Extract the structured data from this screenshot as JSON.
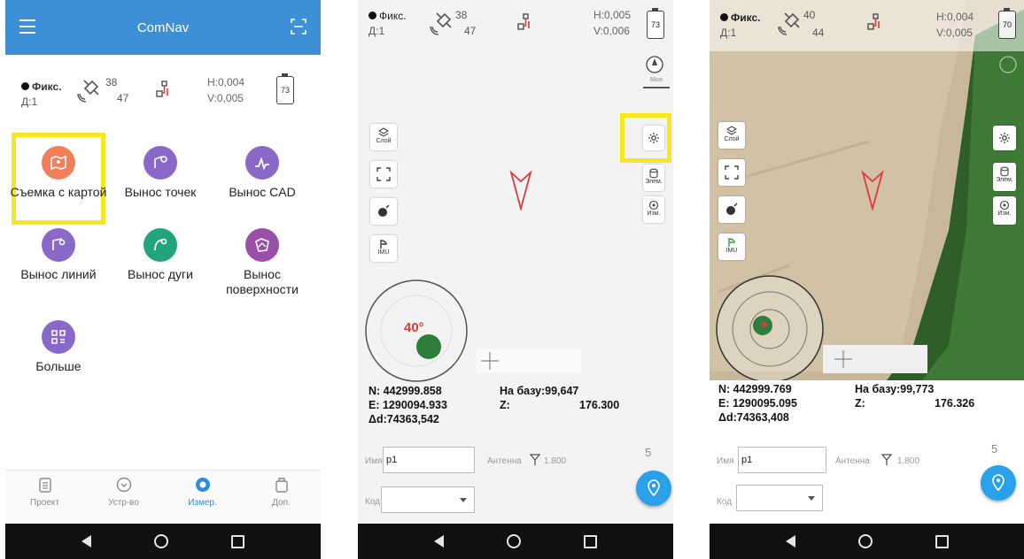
{
  "colors": {
    "accent": "#3d8fd6",
    "highlight": "#f7e620",
    "fab": "#29a0e8",
    "arrow": "#e23a3a",
    "tilt_dot": "#2e7d3a"
  },
  "panel1": {
    "title": "ComNav",
    "status": {
      "fix": "Фикс.",
      "diff": "Д:1",
      "sat_visible": "38",
      "sat_used": "47",
      "h": "H:0,004",
      "v": "V:0,005",
      "battery": "73"
    },
    "tiles": [
      {
        "label": "Съемка с картой",
        "icon": "map-pin-icon",
        "color": "#f07f5a"
      },
      {
        "label": "Вынос точек",
        "icon": "stakeout-point-icon",
        "color": "#8a68c8"
      },
      {
        "label": "Вынос CAD",
        "icon": "cad-line-icon",
        "color": "#8a68c8"
      },
      {
        "label": "Вынос линий",
        "icon": "stakeout-line-icon",
        "color": "#8a68c8"
      },
      {
        "label": "Вынос дуги",
        "icon": "arc-icon",
        "color": "#22a57c"
      },
      {
        "label": "Вынос поверхности",
        "icon": "surface-icon",
        "color": "#9a4fa8"
      },
      {
        "label": "Больше",
        "icon": "grid-icon",
        "color": "#8a68c8"
      }
    ],
    "bottom_tabs": [
      {
        "label": "Проект",
        "icon": "project-icon",
        "active": false
      },
      {
        "label": "Устр-во",
        "icon": "device-icon",
        "active": false
      },
      {
        "label": "Измер.",
        "icon": "measure-icon",
        "active": true
      },
      {
        "label": "Доп.",
        "icon": "extra-icon",
        "active": false
      }
    ]
  },
  "panel2": {
    "status": {
      "fix": "Фикс.",
      "diff": "Д:1",
      "sat_visible": "38",
      "sat_used": "47",
      "h": "H:0,005",
      "v": "V:0,006",
      "battery": "73"
    },
    "scale": "59cm",
    "controls": {
      "layer": "Слой",
      "imu": "IMU",
      "elements": "Элем.",
      "measure": "Изм."
    },
    "tilt": "40°",
    "coords": {
      "n": "N: 442999.858",
      "e": "E: 1290094.933",
      "ad": "Δd:74363,542",
      "base": "На базу:99,647",
      "z_label": "Z:",
      "z": "176.300"
    },
    "name_label": "Имя",
    "name_value": "p1",
    "antenna_label": "Антенна",
    "antenna_value": "1.800",
    "code_label": "Код",
    "count": "5"
  },
  "panel3": {
    "status": {
      "fix": "Фикс.",
      "diff": "Д:1",
      "sat_visible": "40",
      "sat_used": "44",
      "h": "H:0,004",
      "v": "V:0,005",
      "battery": "70"
    },
    "controls": {
      "layer": "Слой",
      "imu": "IMU",
      "elements": "Элем.",
      "measure": "Изм."
    },
    "coords": {
      "n": "N: 442999.769",
      "e": "E: 1290095.095",
      "ad": "Δd:74363,408",
      "base": "На базу:99,773",
      "z_label": "Z:",
      "z": "176.326"
    },
    "name_label": "Имя",
    "name_value": "p1",
    "antenna_label": "Антенна",
    "antenna_value": "1.800",
    "code_label": "Код",
    "count": "5"
  }
}
